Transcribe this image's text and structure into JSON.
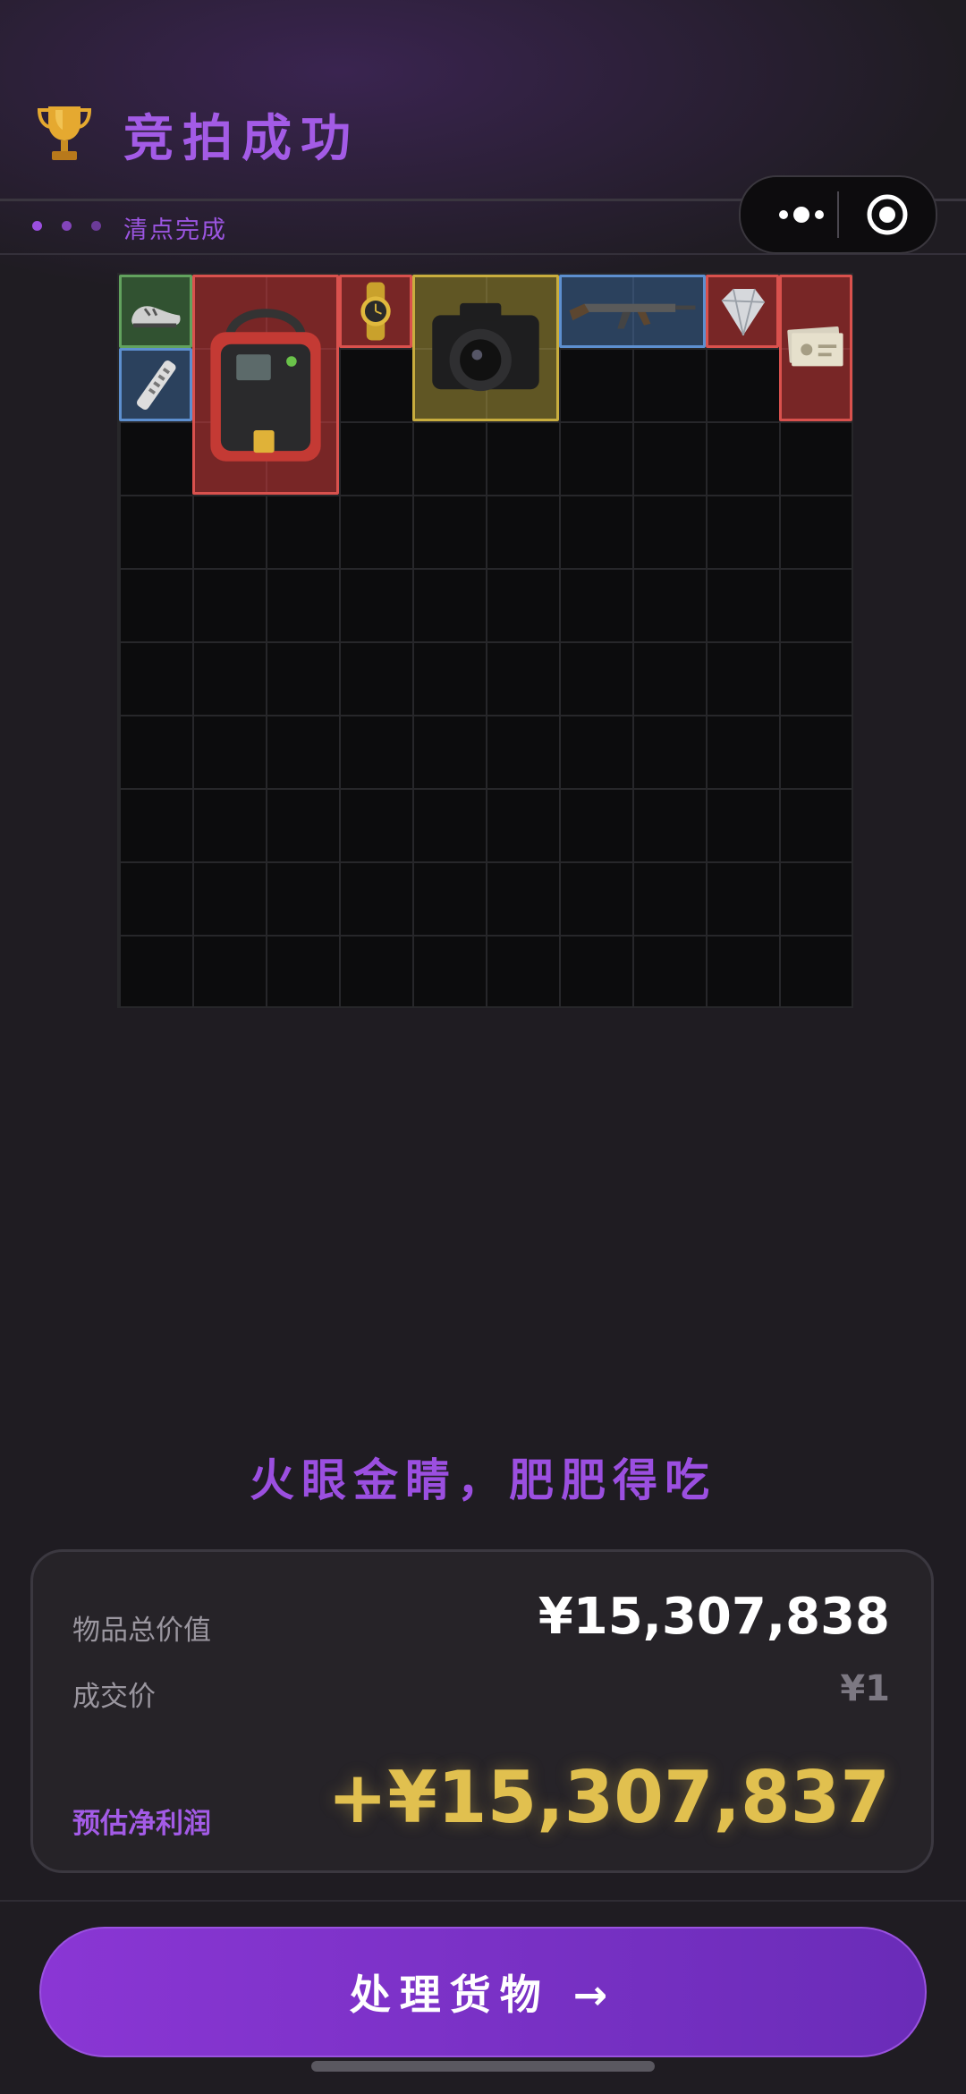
{
  "header": {
    "title": "竞拍成功",
    "subtitle": "清点完成",
    "trophy_icon": "trophy-icon"
  },
  "capsule": {
    "more_icon": "more-dots-icon",
    "close_icon": "record-circle-icon"
  },
  "grid": {
    "columns": 10,
    "rows": 10,
    "items": [
      {
        "name": "green-item-sneaker",
        "rarity": "green"
      },
      {
        "name": "blue-item-remote",
        "rarity": "blue"
      },
      {
        "name": "red-item-defibrillator",
        "rarity": "red"
      },
      {
        "name": "red-item-gold-watch",
        "rarity": "red"
      },
      {
        "name": "gold-item-camera",
        "rarity": "gold"
      },
      {
        "name": "blue-item-rifle",
        "rarity": "blue"
      },
      {
        "name": "red-item-diamond",
        "rarity": "red"
      },
      {
        "name": "red-item-banknotes",
        "rarity": "red"
      }
    ]
  },
  "slogan": "火眼金睛，肥肥得吃",
  "summary": {
    "total_label": "物品总价值",
    "total_value": "¥15,307,838",
    "price_label": "成交价",
    "price_value": "¥1",
    "profit_label": "预估净利润",
    "profit_value": "+¥15,307,837"
  },
  "cta": {
    "label": "处理货物 →"
  },
  "colors": {
    "accent": "#9b4fe0",
    "profit": "#e1c04f",
    "background": "#1f1c22"
  }
}
